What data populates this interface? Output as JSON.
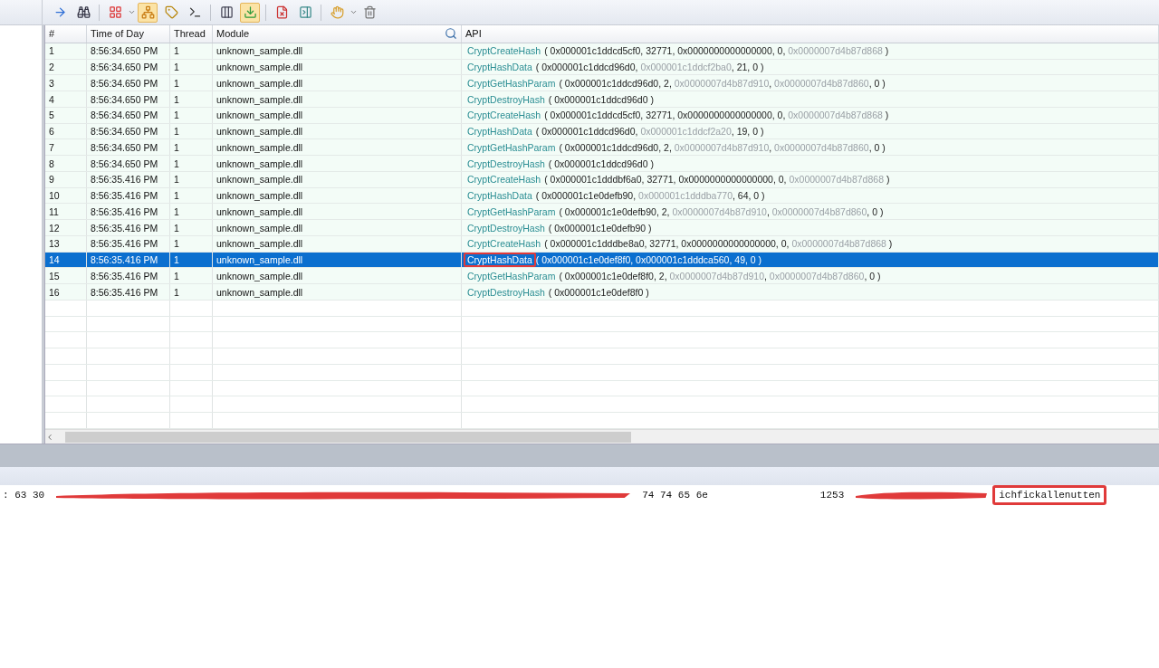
{
  "toolbar": [
    {
      "kind": "arrow",
      "pressed": false
    },
    {
      "kind": "binoculars",
      "pressed": false
    },
    {
      "kind": "sep"
    },
    {
      "kind": "grid",
      "pressed": false
    },
    {
      "kind": "caret",
      "pressed": false
    },
    {
      "kind": "tree",
      "pressed": true
    },
    {
      "kind": "tag",
      "pressed": false
    },
    {
      "kind": "terminal",
      "pressed": false
    },
    {
      "kind": "sep"
    },
    {
      "kind": "columns",
      "pressed": false
    },
    {
      "kind": "download",
      "pressed": true
    },
    {
      "kind": "sep"
    },
    {
      "kind": "filex",
      "pressed": false
    },
    {
      "kind": "panelx",
      "pressed": false
    },
    {
      "kind": "sep"
    },
    {
      "kind": "hand",
      "pressed": false
    },
    {
      "kind": "caret",
      "pressed": false
    },
    {
      "kind": "trash",
      "pressed": false
    }
  ],
  "table": {
    "columns": [
      "#",
      "Time of Day",
      "Thread",
      "Module",
      "API"
    ],
    "rows": [
      {
        "num": "1",
        "time": "8:56:34.650 PM",
        "thread": "1",
        "module": "unknown_sample.dll",
        "selected": false,
        "api": "CryptCreateHash",
        "args": [
          {
            "text": "( 0x000001c1ddcd5cf0, 32771, 0x0000000000000000, 0, ",
            "muted": false
          },
          {
            "text": "0x0000007d4b87d868",
            "muted": true
          },
          {
            "text": " )",
            "muted": false
          }
        ]
      },
      {
        "num": "2",
        "time": "8:56:34.650 PM",
        "thread": "1",
        "module": "unknown_sample.dll",
        "selected": false,
        "api": "CryptHashData",
        "args": [
          {
            "text": "( 0x000001c1ddcd96d0, ",
            "muted": false
          },
          {
            "text": "0x000001c1ddcf2ba0",
            "muted": true
          },
          {
            "text": ", 21, 0 )",
            "muted": false
          }
        ]
      },
      {
        "num": "3",
        "time": "8:56:34.650 PM",
        "thread": "1",
        "module": "unknown_sample.dll",
        "selected": false,
        "api": "CryptGetHashParam",
        "args": [
          {
            "text": "( 0x000001c1ddcd96d0, 2, ",
            "muted": false
          },
          {
            "text": "0x0000007d4b87d910",
            "muted": true
          },
          {
            "text": ", ",
            "muted": false
          },
          {
            "text": "0x0000007d4b87d860",
            "muted": true
          },
          {
            "text": ", 0 )",
            "muted": false
          }
        ]
      },
      {
        "num": "4",
        "time": "8:56:34.650 PM",
        "thread": "1",
        "module": "unknown_sample.dll",
        "selected": false,
        "api": "CryptDestroyHash",
        "args": [
          {
            "text": "( 0x000001c1ddcd96d0 )",
            "muted": false
          }
        ]
      },
      {
        "num": "5",
        "time": "8:56:34.650 PM",
        "thread": "1",
        "module": "unknown_sample.dll",
        "selected": false,
        "api": "CryptCreateHash",
        "args": [
          {
            "text": "( 0x000001c1ddcd5cf0, 32771, 0x0000000000000000, 0, ",
            "muted": false
          },
          {
            "text": "0x0000007d4b87d868",
            "muted": true
          },
          {
            "text": " )",
            "muted": false
          }
        ]
      },
      {
        "num": "6",
        "time": "8:56:34.650 PM",
        "thread": "1",
        "module": "unknown_sample.dll",
        "selected": false,
        "api": "CryptHashData",
        "args": [
          {
            "text": "( 0x000001c1ddcd96d0, ",
            "muted": false
          },
          {
            "text": "0x000001c1ddcf2a20",
            "muted": true
          },
          {
            "text": ", 19, 0 )",
            "muted": false
          }
        ]
      },
      {
        "num": "7",
        "time": "8:56:34.650 PM",
        "thread": "1",
        "module": "unknown_sample.dll",
        "selected": false,
        "api": "CryptGetHashParam",
        "args": [
          {
            "text": "( 0x000001c1ddcd96d0, 2, ",
            "muted": false
          },
          {
            "text": "0x0000007d4b87d910",
            "muted": true
          },
          {
            "text": ", ",
            "muted": false
          },
          {
            "text": "0x0000007d4b87d860",
            "muted": true
          },
          {
            "text": ", 0 )",
            "muted": false
          }
        ]
      },
      {
        "num": "8",
        "time": "8:56:34.650 PM",
        "thread": "1",
        "module": "unknown_sample.dll",
        "selected": false,
        "api": "CryptDestroyHash",
        "args": [
          {
            "text": "( 0x000001c1ddcd96d0 )",
            "muted": false
          }
        ]
      },
      {
        "num": "9",
        "time": "8:56:35.416 PM",
        "thread": "1",
        "module": "unknown_sample.dll",
        "selected": false,
        "api": "CryptCreateHash",
        "args": [
          {
            "text": "( 0x000001c1dddbf6a0, 32771, 0x0000000000000000, 0, ",
            "muted": false
          },
          {
            "text": "0x0000007d4b87d868",
            "muted": true
          },
          {
            "text": " )",
            "muted": false
          }
        ]
      },
      {
        "num": "10",
        "time": "8:56:35.416 PM",
        "thread": "1",
        "module": "unknown_sample.dll",
        "selected": false,
        "api": "CryptHashData",
        "args": [
          {
            "text": "( 0x000001c1e0defb90, ",
            "muted": false
          },
          {
            "text": "0x000001c1dddba770",
            "muted": true
          },
          {
            "text": ", 64, 0 )",
            "muted": false
          }
        ]
      },
      {
        "num": "11",
        "time": "8:56:35.416 PM",
        "thread": "1",
        "module": "unknown_sample.dll",
        "selected": false,
        "api": "CryptGetHashParam",
        "args": [
          {
            "text": "( 0x000001c1e0defb90, 2, ",
            "muted": false
          },
          {
            "text": "0x0000007d4b87d910",
            "muted": true
          },
          {
            "text": ", ",
            "muted": false
          },
          {
            "text": "0x0000007d4b87d860",
            "muted": true
          },
          {
            "text": ", 0 )",
            "muted": false
          }
        ]
      },
      {
        "num": "12",
        "time": "8:56:35.416 PM",
        "thread": "1",
        "module": "unknown_sample.dll",
        "selected": false,
        "api": "CryptDestroyHash",
        "args": [
          {
            "text": "( 0x000001c1e0defb90 )",
            "muted": false
          }
        ]
      },
      {
        "num": "13",
        "time": "8:56:35.416 PM",
        "thread": "1",
        "module": "unknown_sample.dll",
        "selected": false,
        "api": "CryptCreateHash",
        "args": [
          {
            "text": "( 0x000001c1dddbe8a0, 32771, 0x0000000000000000, 0, ",
            "muted": false
          },
          {
            "text": "0x0000007d4b87d868",
            "muted": true
          },
          {
            "text": " )",
            "muted": false
          }
        ]
      },
      {
        "num": "14",
        "time": "8:56:35.416 PM",
        "thread": "1",
        "module": "unknown_sample.dll",
        "selected": true,
        "api": "CryptHashData",
        "args": [
          {
            "text": "( 0x000001c1e0def8f0, 0x000001c1dddca560, 49, 0 )"
          }
        ]
      },
      {
        "num": "15",
        "time": "8:56:35.416 PM",
        "thread": "1",
        "module": "unknown_sample.dll",
        "selected": false,
        "api": "CryptGetHashParam",
        "args": [
          {
            "text": "( 0x000001c1e0def8f0, 2, ",
            "muted": false
          },
          {
            "text": "0x0000007d4b87d910",
            "muted": true
          },
          {
            "text": ", ",
            "muted": false
          },
          {
            "text": "0x0000007d4b87d860",
            "muted": true
          },
          {
            "text": ", 0 )",
            "muted": false
          }
        ]
      },
      {
        "num": "16",
        "time": "8:56:35.416 PM",
        "thread": "1",
        "module": "unknown_sample.dll",
        "selected": false,
        "api": "CryptDestroyHash",
        "args": [
          {
            "text": "( 0x000001c1e0def8f0 )",
            "muted": false
          }
        ]
      }
    ]
  },
  "hex_view": {
    "segments": [
      {
        "text": ": 63 30",
        "redacted_after": true,
        "boxed": false
      },
      {
        "text": "74 74 65 6e",
        "redacted_after": false,
        "boxed": false
      },
      {
        "text": "1253",
        "redacted_after": true,
        "boxed": false
      },
      {
        "text": "ichfickallenutten",
        "redacted_after": false,
        "boxed": true
      }
    ]
  }
}
